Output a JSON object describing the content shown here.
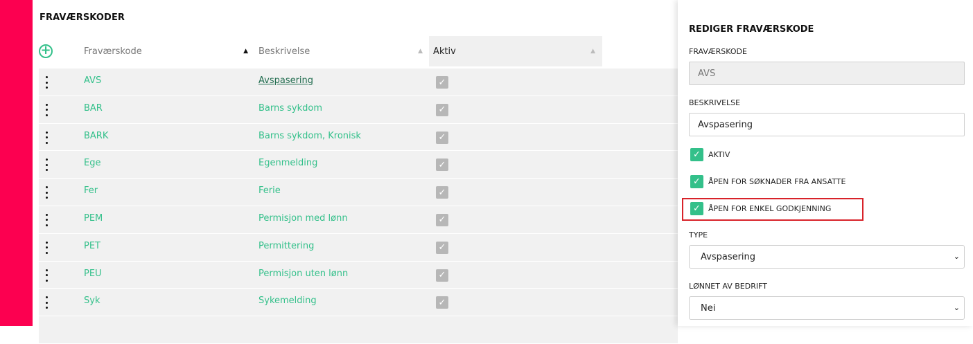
{
  "main": {
    "title": "FRAVÆRSKODER",
    "columns": {
      "code": "Fraværskode",
      "description": "Beskrivelse",
      "active": "Aktiv"
    },
    "rows": [
      {
        "code": "AVS",
        "description": "Avspasering"
      },
      {
        "code": "BAR",
        "description": "Barns sykdom"
      },
      {
        "code": "BARK",
        "description": "Barns sykdom, Kronisk"
      },
      {
        "code": "Ege",
        "description": "Egenmelding"
      },
      {
        "code": "Fer",
        "description": "Ferie"
      },
      {
        "code": "PEM",
        "description": "Permisjon med lønn"
      },
      {
        "code": "PET",
        "description": "Permittering"
      },
      {
        "code": "PEU",
        "description": "Permisjon uten lønn"
      },
      {
        "code": "Syk",
        "description": "Sykemelding"
      }
    ]
  },
  "panel": {
    "title": "REDIGER FRAVÆRSKODE",
    "code_label": "FRAVÆRSKODE",
    "code_value": "AVS",
    "desc_label": "BESKRIVELSE",
    "desc_value": "Avspasering",
    "cb_active": "AKTIV",
    "cb_open_applications": "ÅPEN FOR SØKNADER FRA ANSATTE",
    "cb_open_simple_approval": "ÅPEN FOR ENKEL GODKJENNING",
    "type_label": "TYPE",
    "type_value": "Avspasering",
    "paid_label": "LØNNET AV BEDRIFT",
    "paid_value": "Nei"
  },
  "colors": {
    "brand_red": "#fc0050",
    "accent_green": "#33c08a",
    "highlight_red": "#d8232a"
  }
}
